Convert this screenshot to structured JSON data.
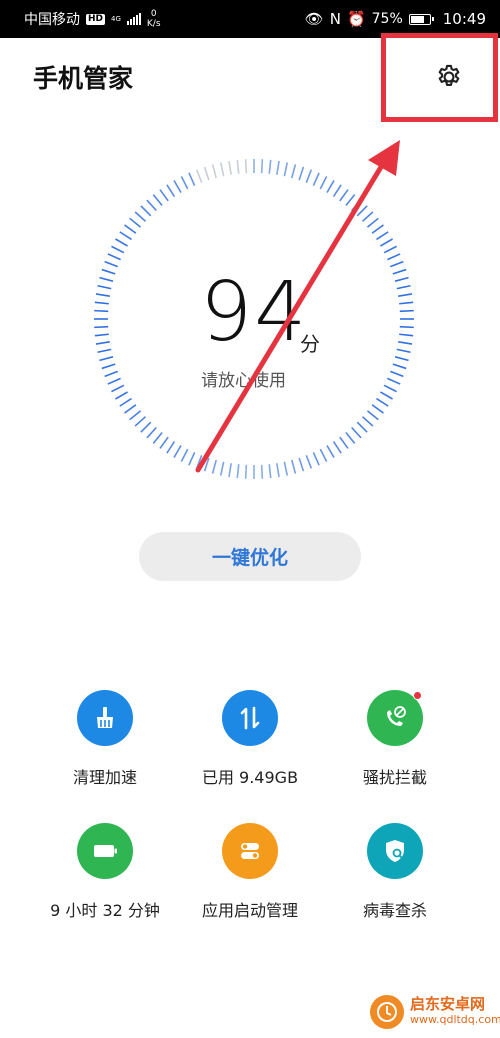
{
  "status_bar": {
    "carrier": "中国移动",
    "hd": "HD",
    "network": "4G",
    "speed_value": "0",
    "speed_unit": "K/s",
    "nfc": "N",
    "battery": "75%",
    "battery_level": 0.75,
    "time": "10:49"
  },
  "header": {
    "title": "手机管家"
  },
  "gauge": {
    "score": "94",
    "unit": "分",
    "status": "请放心使用",
    "accent": "#2f6fe0"
  },
  "optimize": {
    "label": "一键优化"
  },
  "tools": [
    {
      "label": "清理加速",
      "icon": "broom-icon",
      "color": "#1e88e5"
    },
    {
      "label": "已用 9.49GB",
      "icon": "data-transfer-icon",
      "color": "#1e88e5"
    },
    {
      "label": "骚扰拦截",
      "icon": "blocked-call-icon",
      "color": "#2fb653"
    },
    {
      "label": "9 小时 32 分钟",
      "icon": "battery-icon",
      "color": "#2fb653"
    },
    {
      "label": "应用启动管理",
      "icon": "toggles-icon",
      "color": "#f59b1b"
    },
    {
      "label": "病毒查杀",
      "icon": "shield-scan-icon",
      "color": "#0ea5b9"
    }
  ],
  "annotation": {
    "color": "#e5343f"
  },
  "watermark": {
    "name": "启东安卓网",
    "url": "www.qdltdq.com"
  }
}
